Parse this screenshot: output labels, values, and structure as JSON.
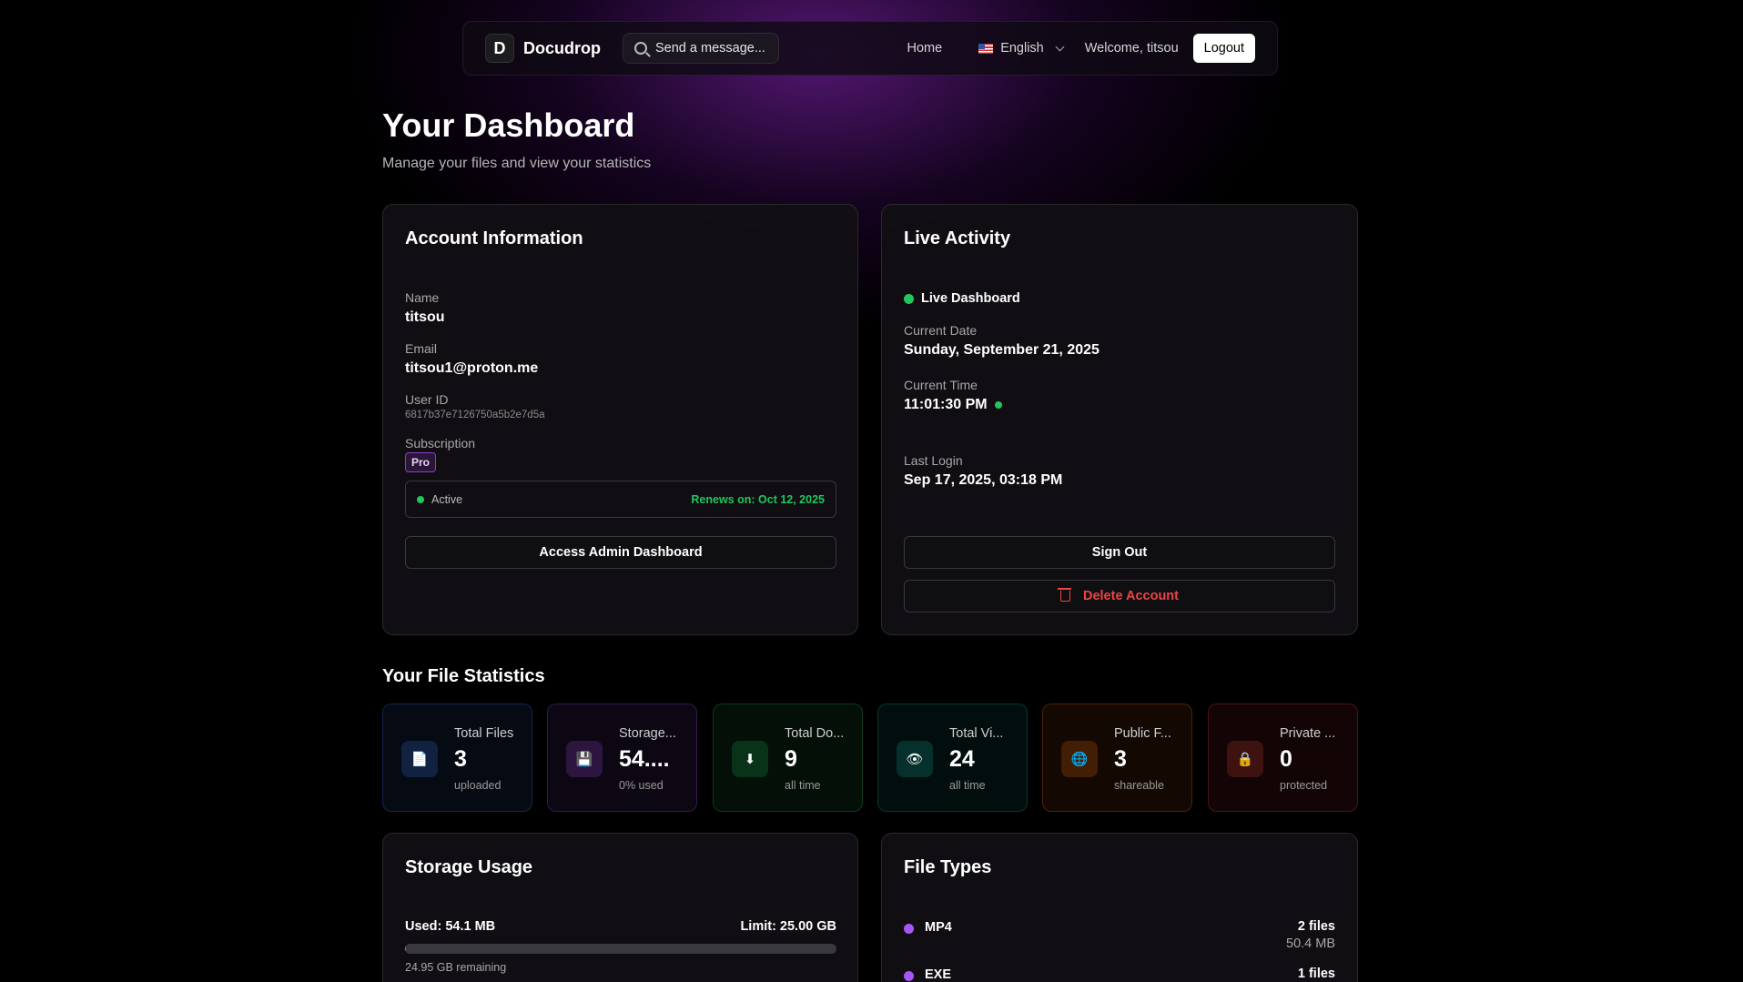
{
  "nav": {
    "logo_letter": "D",
    "brand": "Docudrop",
    "search_placeholder": "Send a message...",
    "home": "Home",
    "language": "English",
    "welcome": "Welcome, titsou",
    "logout": "Logout"
  },
  "header": {
    "title": "Your Dashboard",
    "subtitle": "Manage your files and view your statistics"
  },
  "account": {
    "title": "Account Information",
    "name_label": "Name",
    "name": "titsou",
    "email_label": "Email",
    "email": "titsou1@proton.me",
    "userid_label": "User ID",
    "userid": "6817b37e7126750a5b2e7d5a",
    "subscription_label": "Subscription",
    "plan": "Pro",
    "status": "Active",
    "renews": "Renews on: Oct 12, 2025",
    "admin_button": "Access Admin Dashboard"
  },
  "live": {
    "title": "Live Activity",
    "indicator": "Live Dashboard",
    "date_label": "Current Date",
    "date": "Sunday, September 21, 2025",
    "time_label": "Current Time",
    "time": "11:01:30 PM",
    "last_login_label": "Last Login",
    "last_login": "Sep 17, 2025, 03:18 PM",
    "sign_out": "Sign Out",
    "delete_account": "Delete Account"
  },
  "stats": {
    "title": "Your File Statistics",
    "items": [
      {
        "label": "Total Files",
        "value": "3",
        "sub": "uploaded",
        "icon": "document-icon",
        "glyph": "📄",
        "accent": "#3b82f6"
      },
      {
        "label": "Storage...",
        "value": "54....",
        "sub": "0% used",
        "icon": "floppy-disk-icon",
        "glyph": "💾",
        "accent": "#a855f7"
      },
      {
        "label": "Total Do...",
        "value": "9",
        "sub": "all time",
        "icon": "download-icon",
        "glyph": "⬇",
        "accent": "#22c55e"
      },
      {
        "label": "Total Vi...",
        "value": "24",
        "sub": "all time",
        "icon": "eye-icon",
        "glyph": "👁",
        "accent": "#14b8a6"
      },
      {
        "label": "Public F...",
        "value": "3",
        "sub": "shareable",
        "icon": "globe-icon",
        "glyph": "🌐",
        "accent": "#f97316"
      },
      {
        "label": "Private ...",
        "value": "0",
        "sub": "protected",
        "icon": "lock-icon",
        "glyph": "🔒",
        "accent": "#ef4444"
      }
    ]
  },
  "storage": {
    "title": "Storage Usage",
    "used": "Used: 54.1 MB",
    "limit": "Limit: 25.00 GB",
    "used_fraction": 0.002,
    "remaining": "24.95 GB remaining"
  },
  "filetypes": {
    "title": "File Types",
    "items": [
      {
        "name": "MP4",
        "count": "2 files",
        "size": "50.4 MB"
      },
      {
        "name": "EXE",
        "count": "1 files",
        "size": ""
      }
    ]
  },
  "colors": {
    "accent_green": "#22c55e",
    "danger": "#ef4444",
    "pro_badge": "#8b3fc6"
  }
}
